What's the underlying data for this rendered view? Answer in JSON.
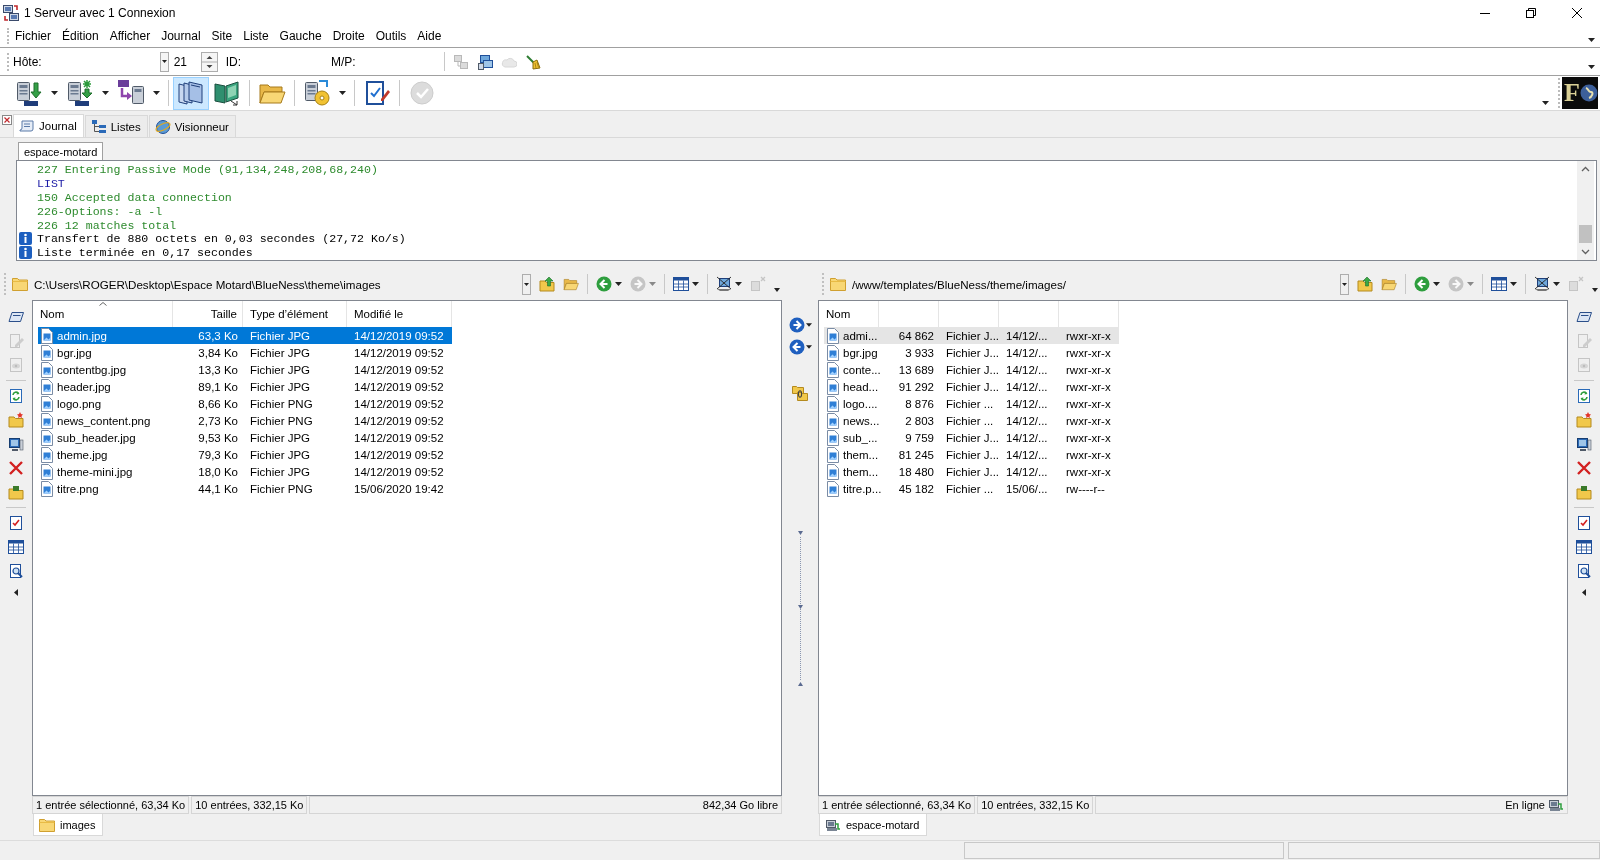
{
  "window": {
    "title": "1 Serveur avec 1 Connexion"
  },
  "menu": [
    "Fichier",
    "Édition",
    "Afficher",
    "Journal",
    "Site",
    "Liste",
    "Gauche",
    "Droite",
    "Outils",
    "Aide"
  ],
  "quick_connect": {
    "host_label": "Hôte:",
    "port": "21",
    "id_label": "ID:",
    "password_label": "M/P:",
    "tools": [
      [
        {
          "kind": "button",
          "disabled": true
        },
        {
          "kind": "button",
          "disabled": false
        },
        {
          "kind": "button",
          "disabled": true
        },
        {
          "kind": "button",
          "disabled": false
        }
      ]
    ]
  },
  "toolbar": {
    "groups": [
      [
        {
          "kind": "dropdown",
          "pressed": false,
          "disabled": false
        },
        {
          "kind": "dropdown",
          "pressed": false,
          "disabled": false
        },
        {
          "kind": "dropdown",
          "pressed": false,
          "disabled": false
        }
      ],
      [
        {
          "kind": "button",
          "pressed": true,
          "disabled": false
        },
        {
          "kind": "button",
          "pressed": false,
          "disabled": false
        }
      ],
      [
        {
          "kind": "button",
          "pressed": false,
          "disabled": false
        }
      ],
      [
        {
          "kind": "dropdown",
          "pressed": false,
          "disabled": false
        }
      ],
      [
        {
          "kind": "button",
          "pressed": false,
          "disabled": false
        }
      ],
      [
        {
          "kind": "button",
          "pressed": false,
          "disabled": true
        }
      ]
    ],
    "logo": "F"
  },
  "view_tabs": [
    {
      "label": "Journal",
      "selected": true
    },
    {
      "label": "Listes",
      "selected": false
    },
    {
      "label": "Visionneur",
      "selected": false
    }
  ],
  "log": {
    "session_tabs": [
      {
        "label": "espace-motard",
        "selected": true
      }
    ],
    "lines": [
      {
        "kind": "reply",
        "text": "227 Entering Passive Mode (91,134,248,208,68,240)"
      },
      {
        "kind": "command",
        "text": "LIST"
      },
      {
        "kind": "reply",
        "text": "150 Accepted data connection"
      },
      {
        "kind": "reply",
        "text": "226-Options: -a -l"
      },
      {
        "kind": "reply",
        "text": "226 12 matches total"
      },
      {
        "kind": "info",
        "text": "Transfert de 880 octets en 0,03 secondes (27,72 Ko/s)"
      },
      {
        "kind": "info",
        "text": "Liste terminée en 0,17 secondes"
      }
    ]
  },
  "panes": [
    {
      "active": true,
      "path": "C:\\Users\\ROGER\\Desktop\\Espace Motard\\BlueNess\\theme\\images",
      "tools": [
        [
          {
            "kind": "button",
            "disabled": false
          },
          {
            "kind": "button",
            "disabled": false
          }
        ],
        [
          {
            "kind": "dropdown",
            "disabled": false
          },
          {
            "kind": "dropdown",
            "disabled": true
          }
        ],
        [
          {
            "kind": "dropdown",
            "disabled": false
          }
        ],
        [
          {
            "kind": "dropdown",
            "disabled": false
          },
          {
            "kind": "button",
            "disabled": true
          }
        ]
      ],
      "side_tools": [
        [
          {
            "kind": "button",
            "disabled": false
          },
          {
            "kind": "button",
            "disabled": true
          },
          {
            "kind": "button",
            "disabled": true
          }
        ],
        [
          {
            "kind": "button",
            "disabled": false
          },
          {
            "kind": "button",
            "disabled": false
          },
          {
            "kind": "button",
            "disabled": false
          },
          {
            "kind": "button",
            "disabled": false
          },
          {
            "kind": "button",
            "disabled": false
          }
        ],
        [
          {
            "kind": "button",
            "disabled": false
          },
          {
            "kind": "button",
            "disabled": false
          },
          {
            "kind": "button",
            "disabled": false
          }
        ]
      ],
      "columns": [
        {
          "label": "Nom",
          "sorted": true
        },
        {
          "label": "Taille",
          "sorted": false
        },
        {
          "label": "Type d’élément",
          "sorted": false
        },
        {
          "label": "Modifié le",
          "sorted": false
        }
      ],
      "rows": [
        {
          "cells": [
            "admin.jpg",
            "63,3 Ko",
            "Fichier JPG",
            "14/12/2019 09:52"
          ],
          "selected": true
        },
        {
          "cells": [
            "bgr.jpg",
            "3,84 Ko",
            "Fichier JPG",
            "14/12/2019 09:52"
          ],
          "selected": false
        },
        {
          "cells": [
            "contentbg.jpg",
            "13,3 Ko",
            "Fichier JPG",
            "14/12/2019 09:52"
          ],
          "selected": false
        },
        {
          "cells": [
            "header.jpg",
            "89,1 Ko",
            "Fichier JPG",
            "14/12/2019 09:52"
          ],
          "selected": false
        },
        {
          "cells": [
            "logo.png",
            "8,66 Ko",
            "Fichier PNG",
            "14/12/2019 09:52"
          ],
          "selected": false
        },
        {
          "cells": [
            "news_content.png",
            "2,73 Ko",
            "Fichier PNG",
            "14/12/2019 09:52"
          ],
          "selected": false
        },
        {
          "cells": [
            "sub_header.jpg",
            "9,53 Ko",
            "Fichier JPG",
            "14/12/2019 09:52"
          ],
          "selected": false
        },
        {
          "cells": [
            "theme.jpg",
            "79,3 Ko",
            "Fichier JPG",
            "14/12/2019 09:52"
          ],
          "selected": false
        },
        {
          "cells": [
            "theme-mini.jpg",
            "18,0 Ko",
            "Fichier JPG",
            "14/12/2019 09:52"
          ],
          "selected": false
        },
        {
          "cells": [
            "titre.png",
            "44,1 Ko",
            "Fichier PNG",
            "15/06/2020 19:42"
          ],
          "selected": false
        }
      ],
      "status": [
        {
          "kind": "text",
          "text": "1 entrée sélectionné, 63,34 Ko"
        },
        {
          "kind": "text",
          "text": "10 entrées, 332,15 Ko"
        },
        {
          "kind": "text",
          "text": "842,34 Go libre"
        }
      ],
      "bottom_tabs": [
        {
          "kind": "folder",
          "label": "images",
          "selected": true
        }
      ]
    },
    {
      "active": false,
      "path": "/www/templates/BlueNess/theme/images/",
      "tools": [
        [
          {
            "kind": "button",
            "disabled": false
          },
          {
            "kind": "button",
            "disabled": false
          }
        ],
        [
          {
            "kind": "dropdown",
            "disabled": false
          },
          {
            "kind": "dropdown",
            "disabled": true
          }
        ],
        [
          {
            "kind": "dropdown",
            "disabled": false
          }
        ],
        [
          {
            "kind": "dropdown",
            "disabled": false
          },
          {
            "kind": "button",
            "disabled": true
          }
        ]
      ],
      "side_tools": [
        [
          {
            "kind": "button",
            "disabled": false
          },
          {
            "kind": "button",
            "disabled": true
          },
          {
            "kind": "button",
            "disabled": true
          }
        ],
        [
          {
            "kind": "button",
            "disabled": false
          },
          {
            "kind": "button",
            "disabled": false
          },
          {
            "kind": "button",
            "disabled": false
          },
          {
            "kind": "button",
            "disabled": false
          },
          {
            "kind": "button",
            "disabled": false
          }
        ],
        [
          {
            "kind": "button",
            "disabled": false
          },
          {
            "kind": "button",
            "disabled": false
          },
          {
            "kind": "button",
            "disabled": false
          }
        ]
      ],
      "columns": [
        {
          "label": "Nom",
          "sorted": false
        }
      ],
      "rows": [
        {
          "cells": [
            "admi...",
            "64 862",
            "Fichier J...",
            "14/12/...",
            "rwxr-xr-x"
          ],
          "selected": true
        },
        {
          "cells": [
            "bgr.jpg",
            "3 933",
            "Fichier J...",
            "14/12/...",
            "rwxr-xr-x"
          ],
          "selected": false
        },
        {
          "cells": [
            "conte...",
            "13 689",
            "Fichier J...",
            "14/12/...",
            "rwxr-xr-x"
          ],
          "selected": false
        },
        {
          "cells": [
            "head...",
            "91 292",
            "Fichier J...",
            "14/12/...",
            "rwxr-xr-x"
          ],
          "selected": false
        },
        {
          "cells": [
            "logo....",
            "8 876",
            "Fichier ...",
            "14/12/...",
            "rwxr-xr-x"
          ],
          "selected": false
        },
        {
          "cells": [
            "news...",
            "2 803",
            "Fichier ...",
            "14/12/...",
            "rwxr-xr-x"
          ],
          "selected": false
        },
        {
          "cells": [
            "sub_...",
            "9 759",
            "Fichier J...",
            "14/12/...",
            "rwxr-xr-x"
          ],
          "selected": false
        },
        {
          "cells": [
            "them...",
            "81 245",
            "Fichier J...",
            "14/12/...",
            "rwxr-xr-x"
          ],
          "selected": false
        },
        {
          "cells": [
            "them...",
            "18 480",
            "Fichier J...",
            "14/12/...",
            "rwxr-xr-x"
          ],
          "selected": false
        },
        {
          "cells": [
            "titre.p...",
            "45 182",
            "Fichier ...",
            "15/06/...",
            "rw----r--"
          ],
          "selected": false
        }
      ],
      "status": [
        {
          "kind": "text",
          "text": "1 entrée sélectionné, 63,34 Ko"
        },
        {
          "kind": "text",
          "text": "10 entrées, 332,15 Ko"
        },
        {
          "kind": "connection",
          "text": "En ligne"
        }
      ],
      "bottom_tabs": [
        {
          "kind": "server",
          "label": "espace-motard",
          "selected": true
        }
      ]
    }
  ],
  "transfer_tools": [
    [
      {
        "kind": "dropdown",
        "disabled": false
      },
      {
        "kind": "dropdown",
        "disabled": false
      }
    ],
    [
      {
        "kind": "button",
        "disabled": false
      }
    ]
  ]
}
